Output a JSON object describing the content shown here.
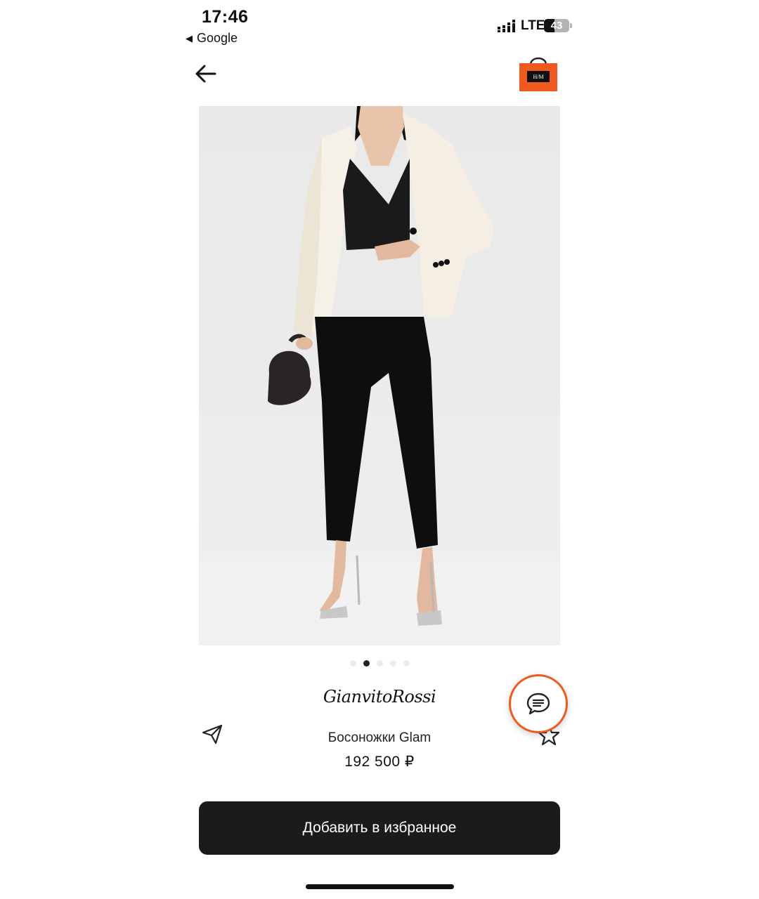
{
  "status_bar": {
    "time": "17:46",
    "back_app_label": "Google",
    "network": "LTE",
    "battery": "43"
  },
  "header": {
    "back_icon": "arrow-left-icon",
    "bag_icon": "shopping-bag-icon",
    "bag_color": "#f05a1e",
    "bag_label": "H/M"
  },
  "gallery": {
    "image_alt": "Model in white blazer, black top and trousers wearing silver heeled sandals",
    "dot_count": 5,
    "active_index": 1
  },
  "product": {
    "brand": "GianvitoRossi",
    "name": "Босоножки Glam",
    "price": "192 500 ₽"
  },
  "actions": {
    "share_icon": "paper-plane-icon",
    "favorite_icon": "star-icon",
    "chat_icon": "chat-bubble-icon",
    "primary_label": "Добавить в избранное",
    "accent_color": "#f05a1e",
    "button_color": "#1b1b1b"
  }
}
